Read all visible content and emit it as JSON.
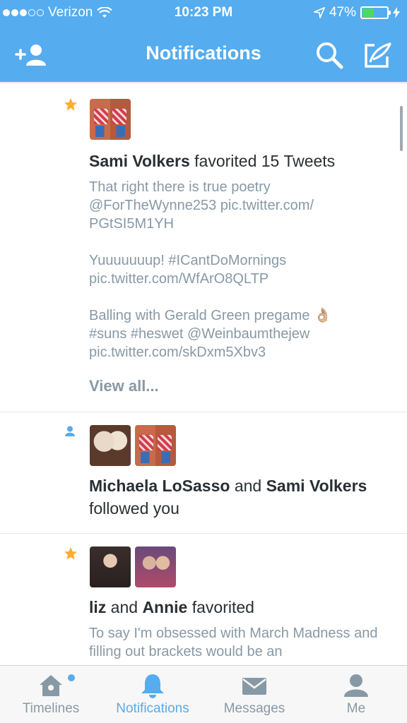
{
  "status_bar": {
    "carrier": "Verizon",
    "time": "10:23 PM",
    "battery": "47%",
    "battery_level": 0.47
  },
  "nav": {
    "title": "Notifications",
    "add_icon": "add-user-icon",
    "search_icon": "search-icon",
    "compose_icon": "compose-icon"
  },
  "notifications": [
    {
      "type": "favorite",
      "actor": "Sami Volkers",
      "action": "favorited 15 Tweets",
      "tweets": [
        "That right there is true poetry @ForTheWynne253 pic.twitter.com/ PGtSI5M1YH",
        "Yuuuuuuup! #ICantDoMornings pic.twitter.com/WfArO8QLTP",
        "Balling with Gerald Green pregame 👌🏼 #suns #heswet @Weinbaumthejew pic.twitter.com/skDxm5Xbv3"
      ],
      "view_all": "View all..."
    },
    {
      "type": "follow",
      "actor1": "Michaela LoSasso",
      "and": "and",
      "actor2": "Sami Volkers",
      "action": "followed you"
    },
    {
      "type": "favorite",
      "actor1": "liz",
      "and": "and",
      "actor2": "Annie",
      "action": "favorited",
      "tweet": "To say I'm obsessed with March Madness and filling out brackets would be an"
    }
  ],
  "tabs": [
    {
      "label": "Timelines",
      "icon": "home-icon"
    },
    {
      "label": "Notifications",
      "icon": "bell-icon"
    },
    {
      "label": "Messages",
      "icon": "envelope-icon"
    },
    {
      "label": "Me",
      "icon": "person-icon"
    }
  ],
  "colors": {
    "brand": "#55acee",
    "star": "#ffac33",
    "text_primary": "#292f33",
    "text_secondary": "#8899a6"
  }
}
